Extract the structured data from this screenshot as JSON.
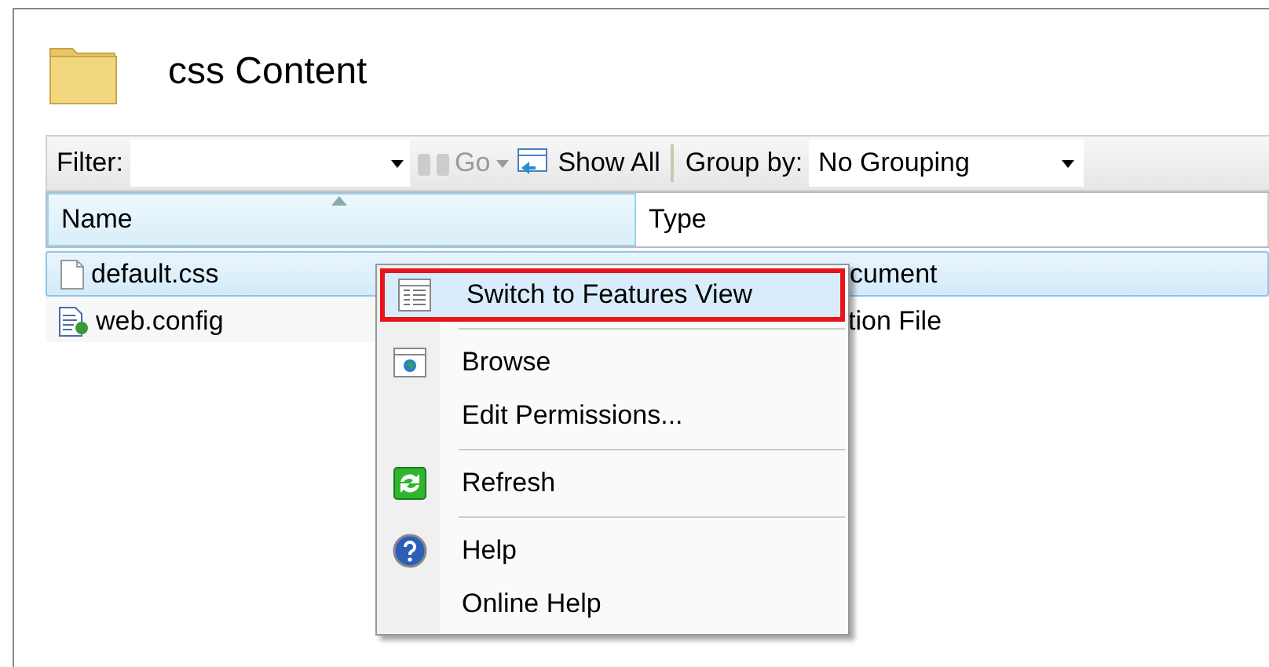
{
  "header": {
    "title": "css Content"
  },
  "toolbar": {
    "filter_label": "Filter:",
    "go": {
      "label": "Go",
      "disabled": true
    },
    "show_all": "Show All",
    "group_by_label": "Group by:",
    "group_by_value": "No Grouping"
  },
  "table": {
    "columns": [
      {
        "label": "Name",
        "sorted": true
      },
      {
        "label": "Type",
        "sorted": false
      }
    ],
    "rows": [
      {
        "name": "default.css",
        "type": "cument",
        "selected": true
      },
      {
        "name": "web.config",
        "type": "tion File",
        "selected": false
      }
    ]
  },
  "context_menu": [
    {
      "kind": "item",
      "label": "Switch to Features View",
      "selected": true
    },
    {
      "kind": "separator"
    },
    {
      "kind": "item",
      "label": "Browse",
      "selected": false
    },
    {
      "kind": "item",
      "label": "Edit Permissions...",
      "selected": false
    },
    {
      "kind": "separator"
    },
    {
      "kind": "item",
      "label": "Refresh",
      "selected": false
    },
    {
      "kind": "separator"
    },
    {
      "kind": "item",
      "label": "Help",
      "selected": false
    },
    {
      "kind": "item",
      "label": "Online Help",
      "selected": false
    }
  ]
}
